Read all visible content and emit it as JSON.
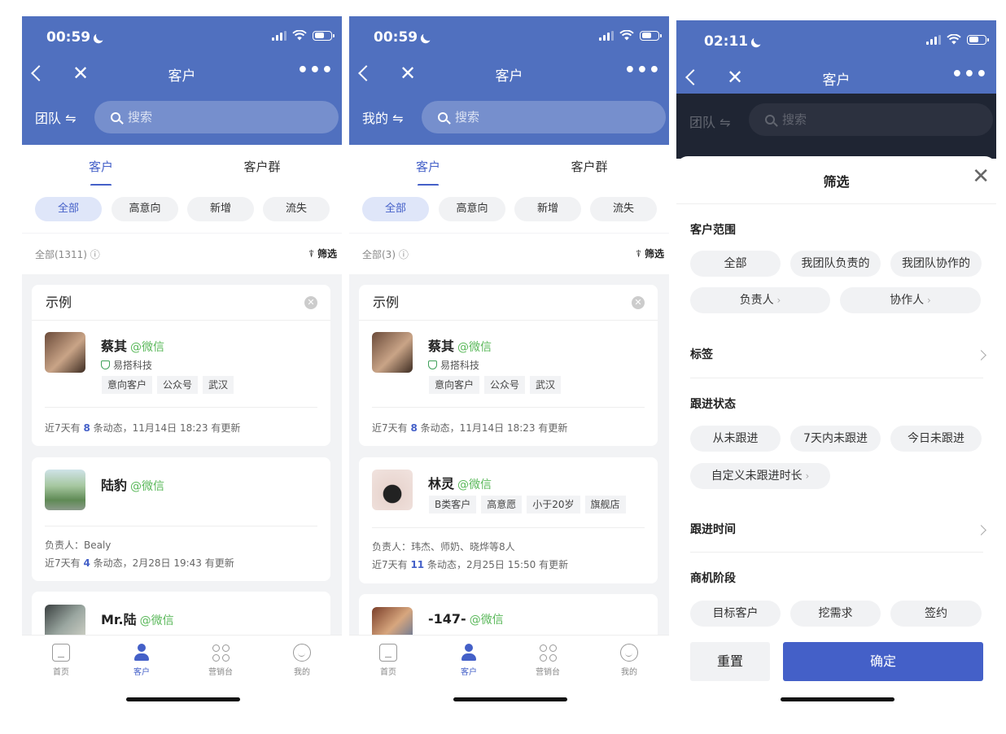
{
  "phones": [
    {
      "time": "00:59",
      "nav_title": "客户",
      "scope": "团队 ⇋",
      "search_placeholder": "搜索",
      "tabs": [
        "客户",
        "客户群"
      ],
      "chips": [
        "全部",
        "高意向",
        "新增",
        "流失"
      ],
      "count": "全部(1311) ⓘ",
      "filter": "筛选",
      "section": "示例",
      "cards": [
        {
          "name": "蔡其",
          "source": "@微信",
          "company": "易搭科技",
          "tags": [
            "意向客户",
            "公众号",
            "武汉"
          ],
          "meta_prefix": "近7天有 ",
          "meta_num": "8",
          "meta_suffix": " 条动态，11月14日 18:23 有更新"
        },
        {
          "name": "陆豹",
          "source": "@微信",
          "owner": "负责人：Bealy",
          "meta_prefix": "近7天有 ",
          "meta_num": "4",
          "meta_suffix": " 条动态，2月28日 19:43 有更新"
        },
        {
          "name": "Mr.陆",
          "source": "@微信"
        }
      ],
      "tabbar": [
        "首页",
        "客户",
        "营销台",
        "我的"
      ]
    },
    {
      "time": "00:59",
      "nav_title": "客户",
      "scope": "我的 ⇋",
      "search_placeholder": "搜索",
      "tabs": [
        "客户",
        "客户群"
      ],
      "chips": [
        "全部",
        "高意向",
        "新增",
        "流失"
      ],
      "count": "全部(3) ⓘ",
      "filter": "筛选",
      "section": "示例",
      "cards": [
        {
          "name": "蔡其",
          "source": "@微信",
          "company": "易搭科技",
          "tags": [
            "意向客户",
            "公众号",
            "武汉"
          ],
          "meta_prefix": "近7天有 ",
          "meta_num": "8",
          "meta_suffix": " 条动态，11月14日 18:23 有更新"
        },
        {
          "name": "林灵",
          "source": "@微信",
          "tags": [
            "B类客户",
            "高意愿",
            "小于20岁",
            "旗舰店"
          ],
          "owner": "负责人：玮杰、师奶、晓烨等8人",
          "meta_prefix": "近7天有 ",
          "meta_num": "11",
          "meta_suffix": " 条动态，2月25日 15:50 有更新"
        },
        {
          "name": "-147-",
          "source": "@微信"
        }
      ],
      "tabbar": [
        "首页",
        "客户",
        "营销台",
        "我的"
      ]
    },
    {
      "time": "02:11",
      "nav_title": "客户",
      "scope": "团队 ⇋",
      "search_placeholder": "搜索",
      "sheet": {
        "title": "筛选",
        "customer_range": {
          "label": "客户范围",
          "options": [
            "全部",
            "我团队负责的",
            "我团队协作的"
          ],
          "sub": [
            "负责人",
            "协作人"
          ]
        },
        "tags_label": "标签",
        "follow_status": {
          "label": "跟进状态",
          "options": [
            "从未跟进",
            "7天内未跟进",
            "今日未跟进"
          ],
          "custom": "自定义未跟进时长"
        },
        "follow_time_label": "跟进时间",
        "stage": {
          "label": "商机阶段",
          "options": [
            "目标客户",
            "挖需求",
            "签约"
          ]
        },
        "reset": "重置",
        "confirm": "确定"
      }
    }
  ],
  "colors": {
    "primary": "#4460c8",
    "header": "#5070bf",
    "wechat": "#5ab85a"
  }
}
